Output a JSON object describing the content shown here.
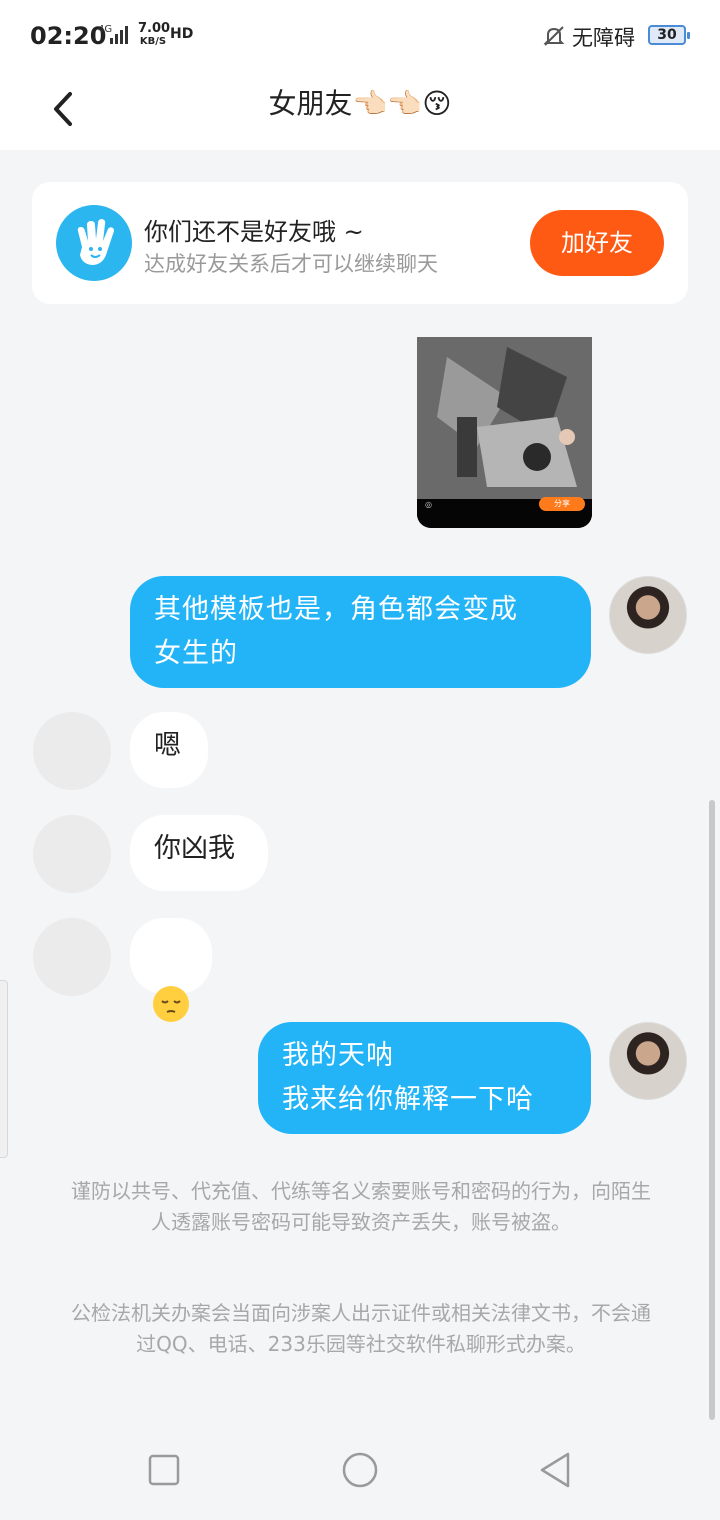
{
  "status_bar": {
    "time": "02:20",
    "network": "4G",
    "speed_value": "7.00",
    "speed_unit": "KB/S",
    "hd": "HD",
    "accessibility_label": "无障碍",
    "battery": "30"
  },
  "header": {
    "title": "女朋友👈🏻👈🏻😚"
  },
  "friend_card": {
    "title": "你们还不是好友哦 ~",
    "subtitle": "达成好友关系后才可以继续聊天",
    "add_button": "加好友"
  },
  "image_message": {
    "share_label": "分享"
  },
  "messages": [
    {
      "side": "out",
      "text": "其他模板也是，角色都会变成\n女生的"
    },
    {
      "side": "in",
      "text": "嗯"
    },
    {
      "side": "in",
      "text": "你凶我"
    },
    {
      "side": "in",
      "text": "",
      "icon": "pensive-face-emoji"
    },
    {
      "side": "out",
      "text": "我的天呐\n我来给你解释一下哈"
    }
  ],
  "notices": [
    "谨防以共号、代充值、代练等名义索要账号和密码的行为，向陌生人透露账号密码可能导致资产丢失，账号被盗。",
    "公检法机关办案会当面向涉案人出示证件或相关法律文书，不会通过QQ、电话、233乐园等社交软件私聊形式办案。"
  ],
  "colors": {
    "outgoing_bubble": "#23b4f7",
    "add_button": "#ff5a14",
    "hand_avatar": "#2bb6f0"
  }
}
